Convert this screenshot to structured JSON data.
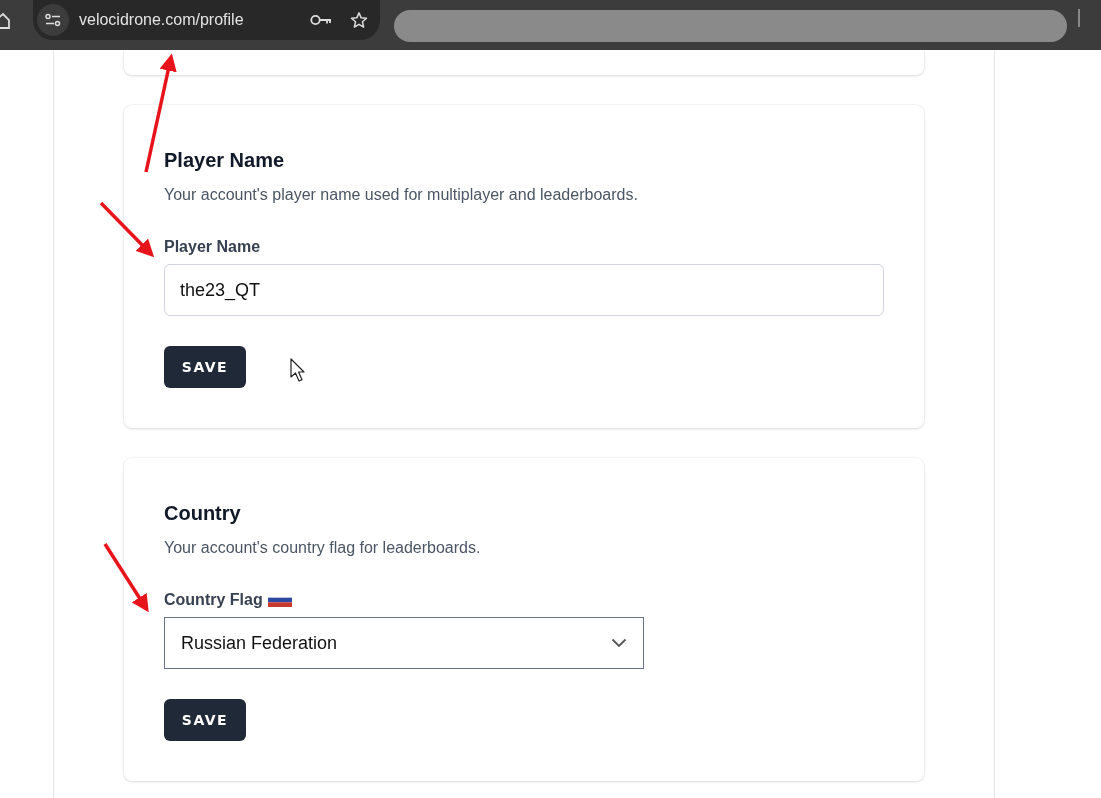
{
  "browser": {
    "url": "velocidrone.com/profile"
  },
  "sections": [
    {
      "kind": "text-field",
      "title": "Player Name",
      "description": "Your account's player name used for multiplayer and leaderboards.",
      "field_label": "Player Name",
      "value": "the23_QT",
      "button": "SAVE"
    },
    {
      "kind": "select",
      "title": "Country",
      "description": "Your account's country flag for leaderboards.",
      "field_label": "Country Flag",
      "value": "Russian Federation",
      "button": "SAVE"
    }
  ]
}
